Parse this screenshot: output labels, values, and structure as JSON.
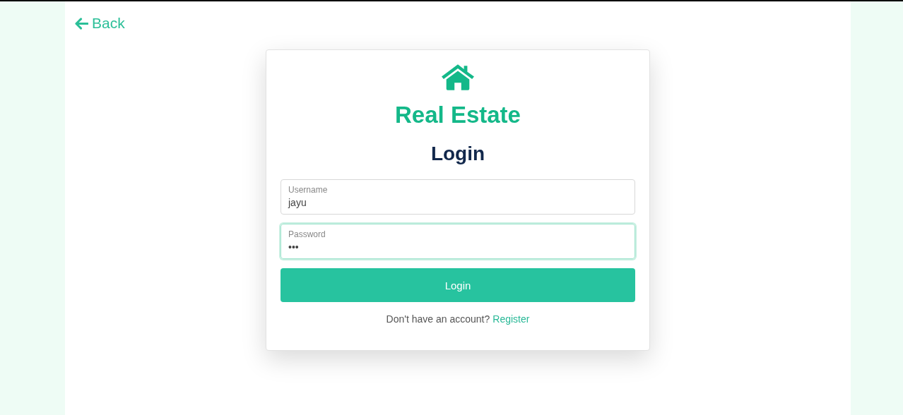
{
  "back_link": {
    "label": "Back"
  },
  "brand": {
    "name": "Real Estate"
  },
  "heading": "Login",
  "fields": [
    {
      "label": "Username",
      "value": "jayu",
      "focused": false
    },
    {
      "label": "Password",
      "value": "•••",
      "focused": true
    }
  ],
  "submit_button": "Login",
  "footer": {
    "text": "Don't have an account?",
    "link": "Register"
  }
}
